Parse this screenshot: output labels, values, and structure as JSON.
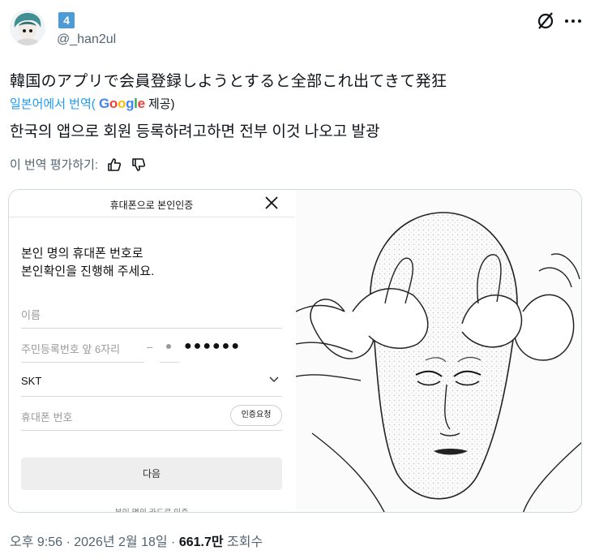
{
  "author": {
    "badge": "4",
    "handle": "@_han2ul"
  },
  "tweet": {
    "original_text": "韓国のアプリで会員登録しようとすると全部これ出てきて発狂",
    "translated_from": "일본어에서 번역",
    "google_label": "Google",
    "provided": "제공)",
    "translated_text": "한국의 앱으로 회원 등록하려고하면 전부 이것 나오고 발광",
    "rate_label": "이 번역 평가하기:"
  },
  "form": {
    "title": "휴대폰으로 본인인증",
    "heading_line1": "본인 명의 휴대폰 번호로",
    "heading_line2": "본인확인을 진행해 주세요.",
    "name_placeholder": "이름",
    "rrn_placeholder": "주민등록번호 앞 6자리",
    "dash": "–",
    "masked_digits": "●●●●●●",
    "carrier_value": "SKT",
    "phone_placeholder": "휴대폰 번호",
    "verify_button": "인증요청",
    "next_button": "다음",
    "bottom_cut_text": "본인 명의 카드로 인증"
  },
  "meta": {
    "time": "오후 9:56 · 2026년 2월 18일 · ",
    "views": "661.7만",
    "views_label": " 조회수"
  },
  "colors": {
    "link": "#1d9bf0",
    "muted": "#536471",
    "badge": "#4c9bd6"
  },
  "icons": [
    "avatar",
    "grok-slash-icon",
    "more-icon",
    "thumbs-up-icon",
    "thumbs-down-icon",
    "close-icon",
    "chevron-down-icon"
  ]
}
